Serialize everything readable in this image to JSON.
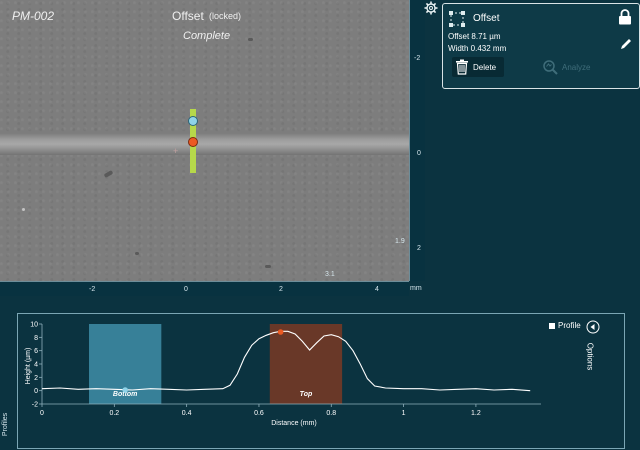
{
  "viewer": {
    "sample_id": "PM-002",
    "overlay_title": "Offset",
    "overlay_lock": "(locked)",
    "overlay_status": "Complete",
    "x_ticks": [
      "-2",
      "0",
      "2",
      "4"
    ],
    "x_unit": "mm",
    "x_marker": "3.1",
    "y_ticks": [
      "-2",
      "0",
      "2"
    ],
    "y_marker": "1.9"
  },
  "panel": {
    "title": "Offset",
    "offset_text": "Offset 8.71 µm",
    "width_text": "Width 0.432 mm",
    "delete_label": "Delete",
    "analyze_label": "Analyze"
  },
  "profile_panel": {
    "tab_label": "Profiles",
    "legend_label": "Profile",
    "options_label": "Options"
  },
  "colors": {
    "background": "#0b3340",
    "profile_line": "#ffffff",
    "bottom_region": "#3f8ea8",
    "top_region": "#7a3a25",
    "marker_green": "#b6d84a",
    "point_blue": "#8fd3e8",
    "point_orange": "#ec5a22"
  },
  "icons": [
    "gear-icon",
    "selection-icon",
    "lock-icon",
    "pencil-icon",
    "trash-icon",
    "analyze-icon",
    "options-arrow-icon"
  ],
  "chart_data": {
    "type": "line",
    "xlabel": "Distance (mm)",
    "ylabel": "Height (µm)",
    "xlim": [
      0,
      1.38
    ],
    "ylim": [
      -2,
      10
    ],
    "x_ticks": [
      "0",
      "0.2",
      "0.4",
      "0.6",
      "0.8",
      "1",
      "1.2"
    ],
    "y_ticks": [
      "10",
      "8",
      "6",
      "4",
      "2",
      "0",
      "-2"
    ],
    "regions": [
      {
        "label": "Bottom",
        "x_start": 0.13,
        "x_end": 0.33,
        "color": "#3f8ea8"
      },
      {
        "label": "Top",
        "x_start": 0.63,
        "x_end": 0.83,
        "color": "#7a3a25"
      }
    ],
    "points": [
      {
        "x": 0.23,
        "y": 0.1,
        "color": "#8fd3e8"
      },
      {
        "x": 0.66,
        "y": 8.8,
        "color": "#ec5a22"
      }
    ],
    "series": [
      {
        "name": "Profile",
        "x": [
          0.0,
          0.05,
          0.1,
          0.15,
          0.2,
          0.25,
          0.3,
          0.35,
          0.4,
          0.45,
          0.5,
          0.52,
          0.54,
          0.56,
          0.58,
          0.6,
          0.62,
          0.64,
          0.66,
          0.68,
          0.7,
          0.72,
          0.74,
          0.76,
          0.78,
          0.8,
          0.82,
          0.84,
          0.86,
          0.88,
          0.9,
          0.92,
          0.95,
          1.0,
          1.05,
          1.1,
          1.15,
          1.2,
          1.25,
          1.3,
          1.35
        ],
        "values": [
          0.3,
          0.4,
          0.2,
          0.3,
          0.2,
          0.1,
          0.3,
          0.2,
          0.1,
          0.2,
          0.3,
          0.8,
          2.5,
          5.0,
          6.8,
          7.8,
          8.3,
          8.7,
          8.9,
          8.9,
          8.5,
          7.4,
          6.1,
          7.2,
          8.2,
          8.4,
          8.1,
          7.4,
          6.0,
          4.0,
          1.8,
          0.7,
          0.4,
          0.3,
          0.3,
          0.1,
          0.2,
          0.3,
          0.1,
          0.2,
          0.0
        ]
      }
    ]
  }
}
